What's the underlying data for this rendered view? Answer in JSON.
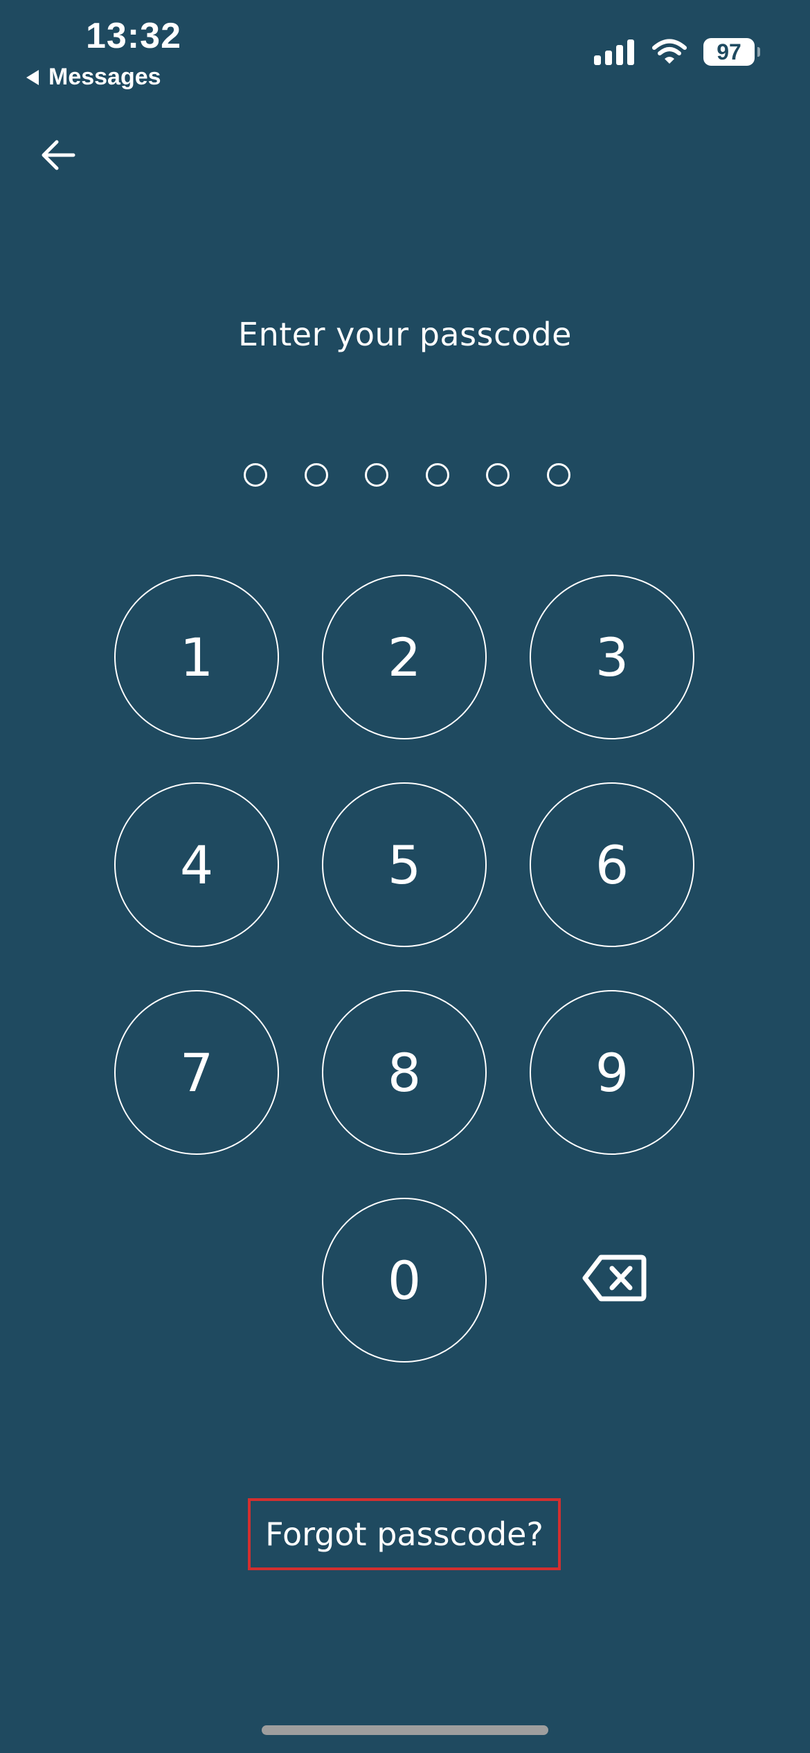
{
  "status_bar": {
    "time": "13:32",
    "back_label": "Messages",
    "battery_level": "97",
    "signal_icon": "cellular-signal-icon",
    "wifi_icon": "wifi-icon"
  },
  "nav": {
    "back_icon": "arrow-left-icon"
  },
  "passcode": {
    "title": "Enter your passcode",
    "length": 6,
    "entered": 0
  },
  "keypad": {
    "keys": [
      "1",
      "2",
      "3",
      "4",
      "5",
      "6",
      "7",
      "8",
      "9",
      "0"
    ],
    "delete_icon": "backspace-icon"
  },
  "forgot_label": "Forgot passcode?",
  "colors": {
    "background": "#1f4a60",
    "foreground": "#ffffff",
    "highlight_border": "#d32f2f"
  }
}
